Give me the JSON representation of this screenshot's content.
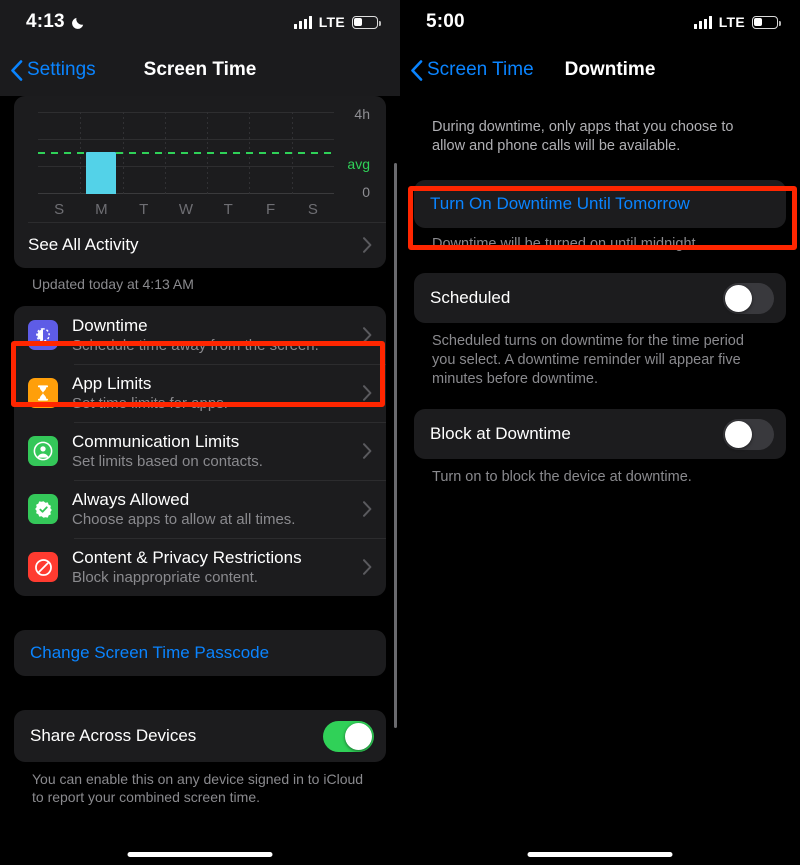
{
  "left_screen": {
    "status_bar": {
      "time": "4:13",
      "moon_icon": "crescent-moon-icon",
      "signal_icon": "cellular-signal-icon",
      "carrier": "LTE",
      "battery_icon": "battery-low-icon"
    },
    "nav": {
      "back_label": "Settings",
      "back_icon": "chevron-left-icon",
      "title": "Screen Time"
    },
    "see_all_activity": {
      "label": "See All Activity",
      "chevron_icon": "chevron-right-icon"
    },
    "updated_note": "Updated today at 4:13 AM",
    "feature_rows": [
      {
        "title": "Downtime",
        "subtitle": "Schedule time away from the screen.",
        "icon": "downtime-moon-icon",
        "icon_color": "#5e5ce6",
        "highlighted": true
      },
      {
        "title": "App Limits",
        "subtitle": "Set time limits for apps.",
        "icon": "hourglass-icon",
        "icon_color": "#ff9f0a",
        "highlighted": false
      },
      {
        "title": "Communication Limits",
        "subtitle": "Set limits based on contacts.",
        "icon": "person-circle-icon",
        "icon_color": "#34c759",
        "highlighted": false
      },
      {
        "title": "Always Allowed",
        "subtitle": "Choose apps to allow at all times.",
        "icon": "checkmark-seal-icon",
        "icon_color": "#34c759",
        "highlighted": false
      },
      {
        "title": "Content & Privacy Restrictions",
        "subtitle": "Block inappropriate content.",
        "icon": "prohibition-icon",
        "icon_color": "#ff3b30",
        "highlighted": false
      }
    ],
    "change_passcode_label": "Change Screen Time Passcode",
    "share_across_devices": {
      "label": "Share Across Devices",
      "toggle_state": "on"
    },
    "share_footnote": "You can enable this on any device signed in to iCloud to report your combined screen time."
  },
  "right_screen": {
    "status_bar": {
      "time": "5:00",
      "signal_icon": "cellular-signal-icon",
      "carrier": "LTE",
      "battery_icon": "battery-low-icon"
    },
    "nav": {
      "back_label": "Screen Time",
      "back_icon": "chevron-left-icon",
      "title": "Downtime"
    },
    "intro": "During downtime, only apps that you choose to allow and phone calls will be available.",
    "turn_on_button": {
      "label": "Turn On Downtime Until Tomorrow",
      "highlighted": true
    },
    "turn_on_footnote": "Downtime will be turned on until midnight.",
    "scheduled": {
      "label": "Scheduled",
      "toggle_state": "off",
      "footnote": "Scheduled turns on downtime for the time period you select. A downtime reminder will appear five minutes before downtime."
    },
    "block_at_downtime": {
      "label": "Block at Downtime",
      "toggle_state": "off",
      "footnote": "Turn on to block the device at downtime."
    }
  },
  "colors": {
    "accent_blue": "#0a84ff",
    "annotation_red": "#ff2600",
    "bar_cyan": "#53d2e8",
    "avg_green": "#2fd158",
    "toggle_green": "#30d158",
    "card_bg": "#1c1c1e"
  },
  "chart_data": {
    "type": "bar",
    "title": "",
    "xlabel": "",
    "ylabel": "",
    "categories": [
      "S",
      "M",
      "T",
      "W",
      "T",
      "F",
      "S"
    ],
    "values": [
      0,
      2.05,
      0,
      0,
      0,
      0,
      0
    ],
    "ylim": [
      0,
      4
    ],
    "ytick_labels": [
      "0",
      "4h"
    ],
    "average_line": {
      "label": "avg",
      "value": 2.05
    },
    "grid": true,
    "legend": "none",
    "unit": "hours"
  }
}
